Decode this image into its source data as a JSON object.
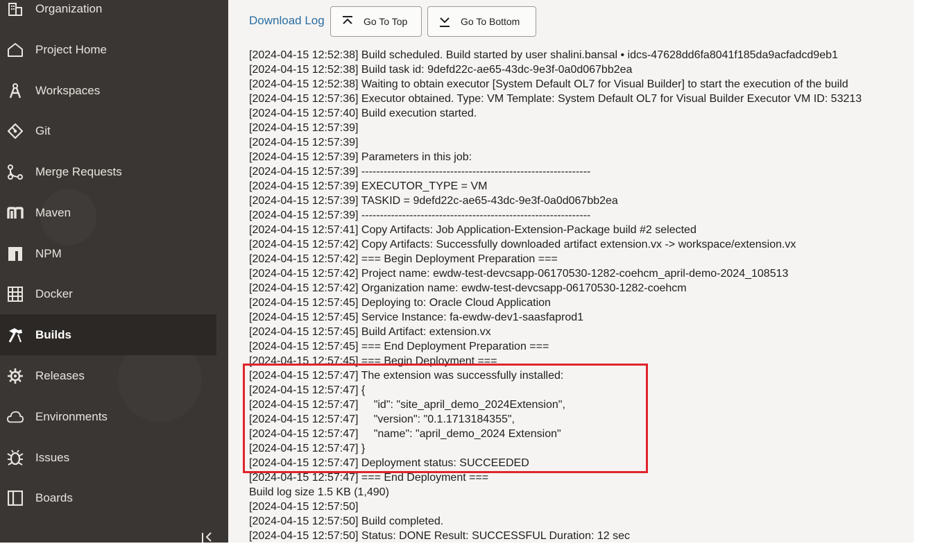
{
  "nav": [
    {
      "label": "Organization",
      "icon": "building-icon",
      "active": false
    },
    {
      "label": "Project Home",
      "icon": "home-icon",
      "active": false
    },
    {
      "label": "Workspaces",
      "icon": "compass-icon",
      "active": false
    },
    {
      "label": "Git",
      "icon": "git-icon",
      "active": false
    },
    {
      "label": "Merge Requests",
      "icon": "merge-icon",
      "active": false
    },
    {
      "label": "Maven",
      "icon": "maven-icon",
      "active": false
    },
    {
      "label": "NPM",
      "icon": "npm-icon",
      "active": false
    },
    {
      "label": "Docker",
      "icon": "docker-icon",
      "active": false
    },
    {
      "label": "Builds",
      "icon": "hammer-icon",
      "active": true
    },
    {
      "label": "Releases",
      "icon": "gear-icon",
      "active": false
    },
    {
      "label": "Environments",
      "icon": "cloud-icon",
      "active": false
    },
    {
      "label": "Issues",
      "icon": "bug-icon",
      "active": false
    },
    {
      "label": "Boards",
      "icon": "board-icon",
      "active": false
    }
  ],
  "toolbar": {
    "download_label": "Download Log",
    "top_label": "Go To Top",
    "bottom_label": "Go To Bottom"
  },
  "log_lines": [
    "[2024-04-15 12:52:38] Build scheduled. Build started by user shalini.bansal • idcs-47628dd6fa8041f185da9acfadcd9eb1",
    "[2024-04-15 12:52:38] Build task id: 9defd22c-ae65-43dc-9e3f-0a0d067bb2ea",
    "[2024-04-15 12:52:38] Waiting to obtain executor [System Default OL7 for Visual Builder] to start the execution of the build",
    "[2024-04-15 12:57:36] Executor obtained. Type: VM Template: System Default OL7 for Visual Builder Executor VM ID: 53213",
    "[2024-04-15 12:57:40] Build execution started.",
    "[2024-04-15 12:57:39]",
    "[2024-04-15 12:57:39]",
    "[2024-04-15 12:57:39] Parameters in this job:",
    "[2024-04-15 12:57:39] --------------------------------------------------------------",
    "[2024-04-15 12:57:39] EXECUTOR_TYPE = VM",
    "[2024-04-15 12:57:39] TASKID = 9defd22c-ae65-43dc-9e3f-0a0d067bb2ea",
    "[2024-04-15 12:57:39] --------------------------------------------------------------",
    "[2024-04-15 12:57:41] Copy Artifacts: Job Application-Extension-Package build #2 selected",
    "[2024-04-15 12:57:42] Copy Artifacts: Successfully downloaded artifact extension.vx -> workspace/extension.vx",
    "[2024-04-15 12:57:42] === Begin Deployment Preparation ===",
    "[2024-04-15 12:57:42] Project name: ewdw-test-devcsapp-06170530-1282-coehcm_april-demo-2024_108513",
    "[2024-04-15 12:57:42] Organization name: ewdw-test-devcsapp-06170530-1282-coehcm",
    "[2024-04-15 12:57:45] Deploying to: Oracle Cloud Application",
    "[2024-04-15 12:57:45] Service Instance: fa-ewdw-dev1-saasfaprod1",
    "[2024-04-15 12:57:45] Build Artifact: extension.vx",
    "[2024-04-15 12:57:45] === End Deployment Preparation ===",
    "[2024-04-15 12:57:45] === Begin Deployment ===",
    "[2024-04-15 12:57:47] The extension was successfully installed:",
    "[2024-04-15 12:57:47] {",
    "[2024-04-15 12:57:47]     \"id\": \"site_april_demo_2024Extension\",",
    "[2024-04-15 12:57:47]     \"version\": \"0.1.1713184355\",",
    "[2024-04-15 12:57:47]     \"name\": \"april_demo_2024 Extension\"",
    "[2024-04-15 12:57:47] }",
    "[2024-04-15 12:57:47] Deployment status: SUCCEEDED",
    "[2024-04-15 12:57:47] === End Deployment ===",
    "Build log size 1.5 KB (1,490)",
    "[2024-04-15 12:57:50]",
    "[2024-04-15 12:57:50] Build completed.",
    "[2024-04-15 12:57:50] Status: DONE Result: SUCCESSFUL Duration: 12 sec"
  ],
  "colors": {
    "sidebar_bg": "#3a3633",
    "active_bg": "#2b2826",
    "link": "#2a6ea1",
    "highlight": "#e0232b"
  }
}
